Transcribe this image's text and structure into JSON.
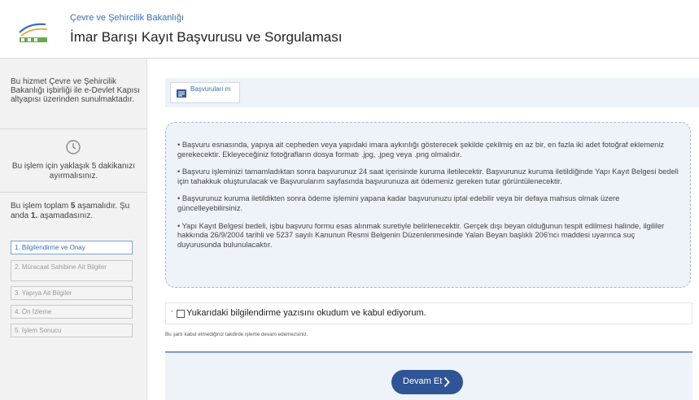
{
  "header": {
    "ministry": "Çevre ve Şehircilik Bakanlığı",
    "title": "İmar Barışı Kayıt Başvurusu ve Sorgulaması",
    "logo_icon": "ministry-logo-icon"
  },
  "sidebar": {
    "info": "Bu hizmet Çevre ve Şehircilik Bakanlığı işbirliği ile e-Devlet Kapısı altyapısı üzerinden sunulmaktadır.",
    "time_icon": "clock-icon",
    "time_text": "Bu işlem için yaklaşık 5 dakikanızı ayırmalısınız.",
    "steps_info_pre": "Bu işlem toplam ",
    "steps_total": "5",
    "steps_info_mid": " aşamalıdır. Şu anda ",
    "steps_current": "1.",
    "steps_info_post": " aşamadasınız.",
    "steps": [
      "1. Bilgilendirme ve Onay",
      "2. Müracaat Sahibine Ait Bilgiler",
      "3. Yapıya Ait Bilgiler",
      "4. Ön İzleme",
      "5. İşlem Sonucu"
    ]
  },
  "toolbar": {
    "tab_label": "Başvuruları m",
    "tab_icon": "document-list-icon"
  },
  "notice": {
    "paragraphs": [
      "• Başvuru esnasında, yapıya ait cepheden veya yapıdaki imara aykırılığı gösterecek şekilde çekilmiş en az bir, en fazla iki adet fotoğraf eklemeniz gerekecektir. Ekleyeceğiniz fotoğrafların dosya formatı .jpg, .jpeg veya .png olmalıdır.",
      "• Başvuru işleminizi tamamladıktan sonra başvurunuz 24 saat içerisinde kuruma iletilecektir. Başvurunuz kuruma iletildiğinde Yapı Kayıt Belgesi bedeli için tahakkuk oluşturulacak ve Başvurularım sayfasında başvurunuza ait ödemeniz gereken tutar görüntülenecektir.",
      "• Başvurunuz kuruma iletildikten sonra ödeme işlemini yapana kadar başvurunuzu iptal edebilir veya bir defaya mahsus olmak üzere güncelleyebilirsiniz.",
      "• Yapı Kayıt Belgesi bedeli, işbu başvuru formu esas alınmak suretiyle belirlenecektir. Gerçek dışı beyan olduğunun tespit edilmesi halinde, ilgililer hakkında 26/9/2004 tarihli ve 5237 sayılı Kanunun Resmi Belgenin Düzenlenmesinde Yalan Beyan başlıklı 206'ncı maddesi uyarınca suç duyurusunda bulunulacaktır."
    ]
  },
  "agreement": {
    "required_mark": "*",
    "label": "Yukarıdaki bilgilendirme yazısını okudum ve kabul ediyorum.",
    "checked": false,
    "warning": "Bu şartı kabul etmediğiniz takdirde işleme devam edemezsiniz."
  },
  "footer": {
    "continue_label": "Devam Et",
    "continue_icon": "chevron-right-icon",
    "accent": "#2f5596"
  }
}
